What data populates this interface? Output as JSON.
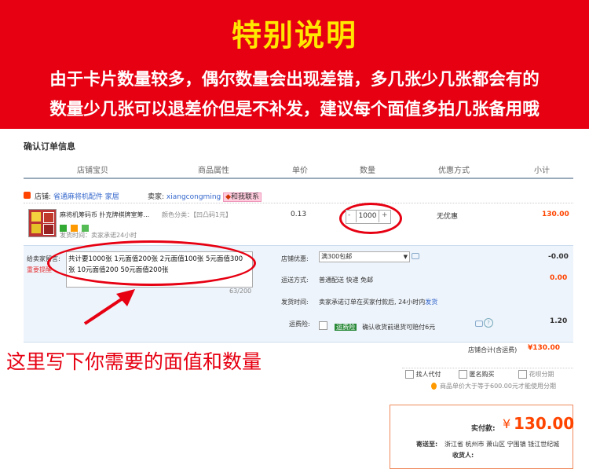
{
  "banner": {
    "title": "特别说明",
    "line1": "由于卡片数量较多，偶尔数量会出现差错，多几张少几张都会有的",
    "line2": "数量少几张可以退差价但是不补发，建议每个面值多拍几张备用哦"
  },
  "section_title": "确认订单信息",
  "table_headers": [
    "店铺宝贝",
    "商品属性",
    "单价",
    "数量",
    "优惠方式",
    "小计"
  ],
  "shop": {
    "label": "店铺:",
    "name": "省通麻将机配件 家居",
    "seller_label": "卖家:",
    "seller": "xiangcongming",
    "contact": "和我联系"
  },
  "item": {
    "title": "麻将机筹码币 扑克牌棋牌室筹...",
    "attr": "颜色分类：【凹凸码1元】",
    "delivery": "发货时间：卖家承诺24小时",
    "price": "0.13",
    "qty_minus": "-",
    "qty": "1000",
    "qty_plus": "+",
    "discount": "无优惠",
    "subtotal": "130.00"
  },
  "message": {
    "label": "给卖家留言:",
    "reminder": "重要提醒",
    "text": "共计要1000张 1元面值200张 2元面值100张 5元面值300张 10元面值200 50元面值200张",
    "count": "63/200"
  },
  "shop_discount": {
    "label": "店铺优惠:",
    "value": "满300包邮",
    "amount": "-0.00"
  },
  "shipping": {
    "label": "运送方式:",
    "value": "普通配送 快递 免邮",
    "amount": "0.00"
  },
  "ship_time": {
    "label": "发货时间:",
    "text": "卖家承诺订单在买家付款后, 24小时内",
    "link": "发货"
  },
  "insurance": {
    "label": "运费险:",
    "badge": "运费险",
    "text": "确认收货前退货可赔付6元",
    "amount": "1.20"
  },
  "shop_total": {
    "label": "店铺合计(含运费)",
    "value": "¥130.00"
  },
  "options": {
    "proxy": "找人代付",
    "anonymous": "匿名购买",
    "huabei": "花呗分期",
    "huabei_note": "商品单价大于等于600.00元才能使用分期"
  },
  "annotation": "这里写下你需要的面值和数量",
  "payment": {
    "label": "实付款:",
    "currency": "¥",
    "amount": "130.00",
    "ship_to_label": "寄送至:",
    "address": "浙江省 杭州市 萧山区 宁围镇 钱江世纪城",
    "recipient_label": "收货人:"
  },
  "colors": {
    "banner_bg": "#e60012",
    "banner_title": "#ffe700",
    "price_orange": "#ff4400",
    "annotation_red": "#e60012"
  }
}
